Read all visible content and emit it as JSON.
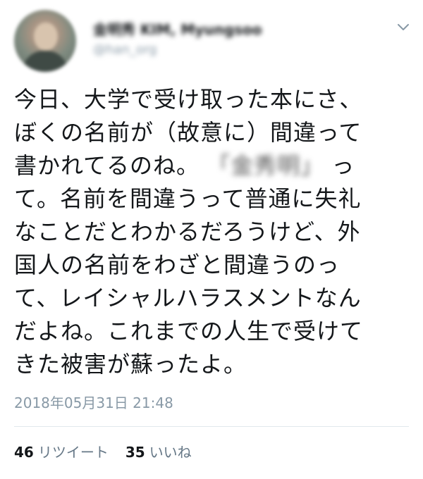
{
  "user": {
    "display_name": "金明秀 KIM, Myungsoo",
    "handle": "@han_org"
  },
  "tweet": {
    "text_part1": "今日、大学で受け取った本にさ、\nぼくの名前が（故意に）間違って\n書かれてるのね。",
    "redacted_name": "「金秀明」",
    "text_part2": "っ\nて。名前を間違うって普通に失礼\nなことだとわかるだろうけど、外\n国人の名前をわざと間違うのっ\nて、レイシャルハラスメントなん\nだよね。これまでの人生で受けて\nきた被害が蘇ったよ。",
    "timestamp": "2018年05月31日 21:48"
  },
  "stats": {
    "retweet_count": "46",
    "retweet_label": "リツイート",
    "like_count": "35",
    "like_label": "いいね"
  },
  "icons": {
    "menu": "chevron-down-icon",
    "avatar": "avatar"
  },
  "colors": {
    "text_primary": "#14171a",
    "text_secondary": "#8899a6",
    "divider": "#e1e8ed"
  }
}
